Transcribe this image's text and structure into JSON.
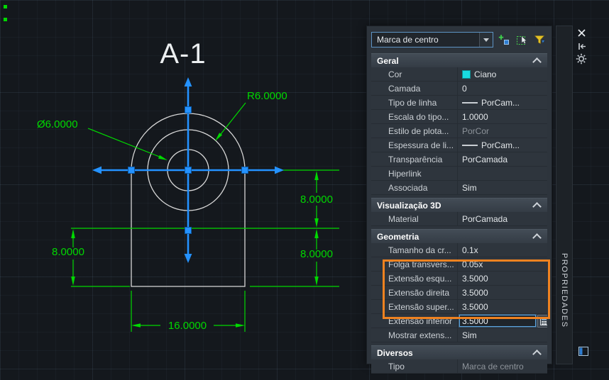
{
  "canvas": {
    "title": "A-1",
    "labels": {
      "radius": "R6.0000",
      "diameter": "Ø6.0000",
      "dim_right_upper": "8.0000",
      "dim_right_lower": "8.0000",
      "dim_left": "8.0000",
      "dim_bottom": "16.0000"
    },
    "colors": {
      "background": "#14181d",
      "geometry": "#d8d8d8",
      "dimension_green": "#00d800",
      "center_mark_blue": "#2492ff"
    }
  },
  "palette": {
    "title": "PROPRIEDADES",
    "object_selector": "Marca de centro",
    "accent": {
      "highlight_box": "#ef8220",
      "edit_border": "#5aa2dc",
      "cyan_swatch": "#19dbe0"
    },
    "icons": {
      "combo_dropdown": "chevron-down",
      "pickadd": "plus-cursor",
      "select_objects": "cursor-dashed-box",
      "quick_select": "funnel",
      "section_collapse": "chevron-up",
      "close": "x",
      "auto_hide": "arrow-to-bar",
      "settings": "gear",
      "quickcalc": "calculator"
    },
    "sections": [
      {
        "label": "Geral",
        "rows": [
          {
            "label": "Cor",
            "value": "Ciano"
          },
          {
            "label": "Camada",
            "value": "0"
          },
          {
            "label": "Tipo de linha",
            "value": "PorCam..."
          },
          {
            "label": "Escala do tipo...",
            "value": "1.0000"
          },
          {
            "label": "Estilo de plota...",
            "value": "PorCor"
          },
          {
            "label": "Espessura de li...",
            "value": "PorCam..."
          },
          {
            "label": "Transparência",
            "value": "PorCamada"
          },
          {
            "label": "Hiperlink",
            "value": ""
          },
          {
            "label": "Associada",
            "value": "Sim"
          }
        ]
      },
      {
        "label": "Visualização 3D",
        "rows": [
          {
            "label": "Material",
            "value": "PorCamada"
          }
        ]
      },
      {
        "label": "Geometria",
        "rows": [
          {
            "label": "Tamanho da cr...",
            "value": "0.1x"
          },
          {
            "label": "Folga transvers...",
            "value": "0.05x"
          },
          {
            "label": "Extensão esqu...",
            "value": "3.5000"
          },
          {
            "label": "Extensão direita",
            "value": "3.5000"
          },
          {
            "label": "Extensão super...",
            "value": "3.5000"
          },
          {
            "label": "Extensão inferior",
            "value": "3.5000"
          },
          {
            "label": "Mostrar extens...",
            "value": "Sim"
          }
        ]
      },
      {
        "label": "Diversos",
        "rows": [
          {
            "label": "Tipo",
            "value": "Marca de centro"
          }
        ]
      }
    ]
  }
}
